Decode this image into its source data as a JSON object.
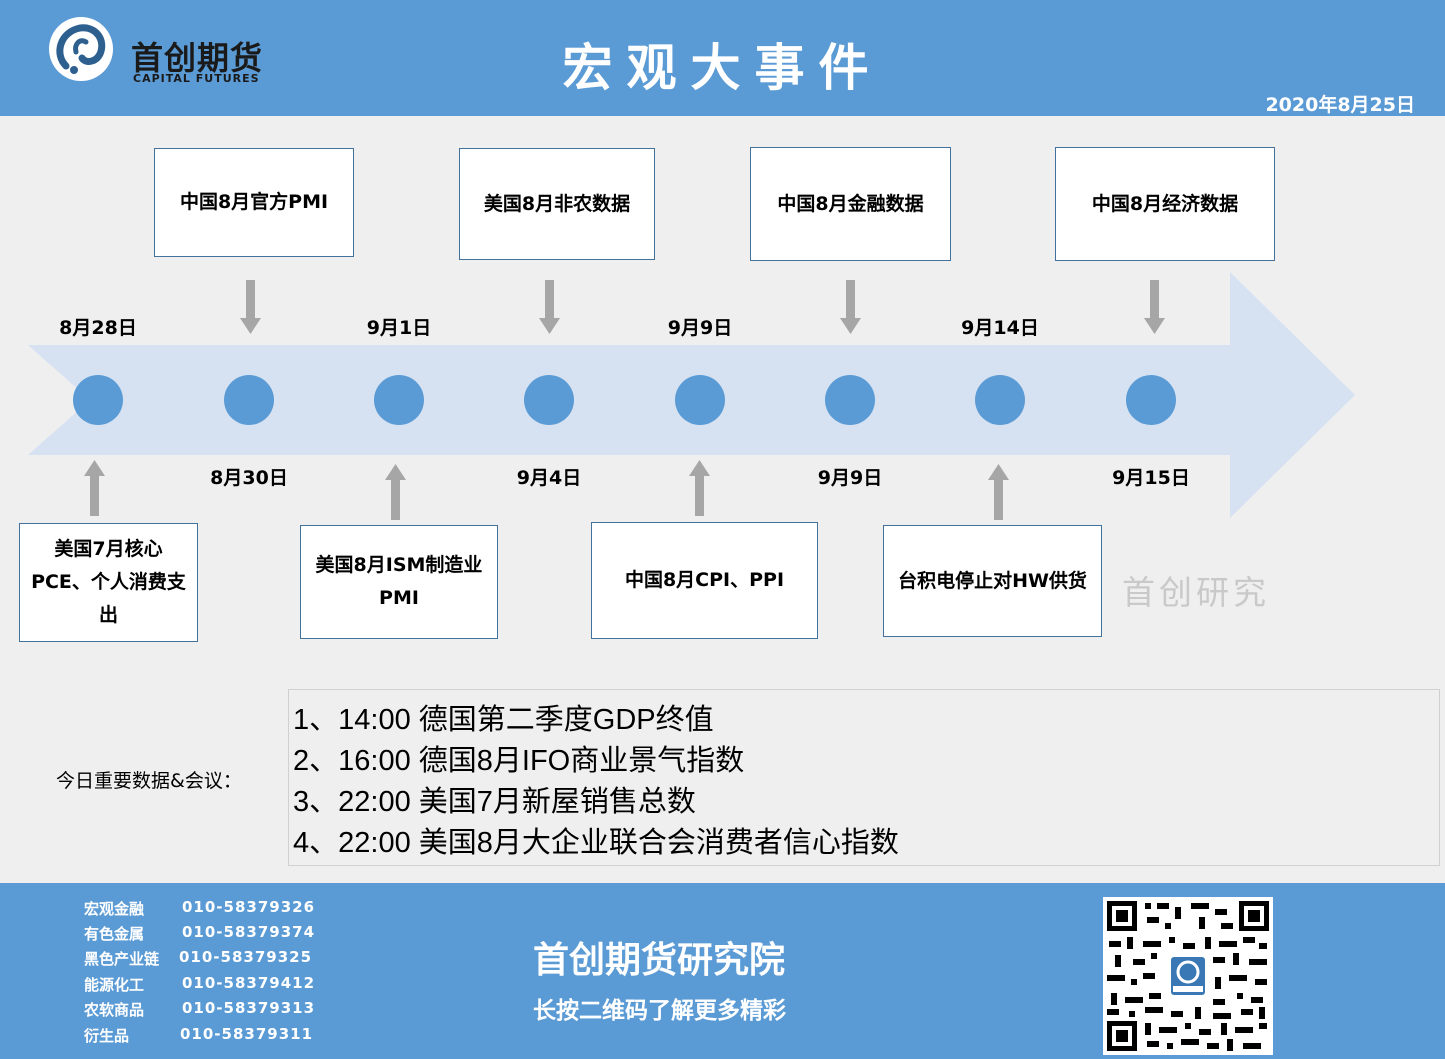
{
  "header": {
    "logo_cn": "首创期货",
    "logo_en": "CAPITAL FUTURES",
    "title": "宏观大事件",
    "date": "2020年8月25日"
  },
  "timeline": {
    "top_dates": [
      "8月28日",
      "9月1日",
      "9月9日",
      "9月14日"
    ],
    "bottom_dates": [
      "8月30日",
      "9月4日",
      "9月9日",
      "9月15日"
    ],
    "top_events": [
      "中国8月官方PMI",
      "美国8月非农数据",
      "中国8月金融数据",
      "中国8月经济数据"
    ],
    "bottom_events": [
      "美国7月核心PCE、个人消费支出",
      "美国8月ISM制造业PMI",
      "中国8月CPI、PPI",
      "台积电停止对HW供货"
    ],
    "colors": {
      "node": "#5b9bd5",
      "arrow": "#d6e2f2",
      "connector": "#a6a6a6"
    }
  },
  "watermark": "首创研究",
  "today": {
    "label": "今日重要数据&会议：",
    "items": [
      "1、14:00 德国第二季度GDP终值",
      "2、16:00 德国8月IFO商业景气指数",
      "3、22:00 美国7月新屋销售总数",
      "4、22:00 美国8月大企业联合会消费者信心指数"
    ]
  },
  "footer": {
    "contacts": [
      {
        "name": "宏观金融",
        "phone": "010-58379326"
      },
      {
        "name": "有色金属",
        "phone": "010-58379374"
      },
      {
        "name": "黑色产业链",
        "phone": "010-58379325"
      },
      {
        "name": "能源化工",
        "phone": "010-58379412"
      },
      {
        "name": "农软商品",
        "phone": "010-58379313"
      },
      {
        "name": "衍生品",
        "phone": "010-58379311"
      }
    ],
    "institute": "首创期货研究院",
    "slogan": "长按二维码了解更多精彩",
    "qr_icon": "qr-code-icon"
  }
}
